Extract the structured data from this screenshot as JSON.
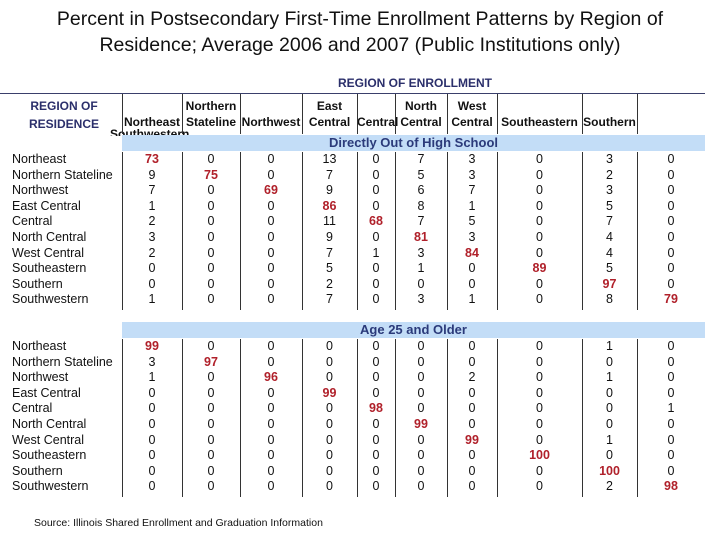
{
  "title_line1": "Percent in Postsecondary First-Time Enrollment Patterns by Region of",
  "title_line2": "Residence; Average 2006 and 2007 (Public Institutions only)",
  "enrollment_header": "REGION OF ENROLLMENT",
  "residence_header_line1": "REGION OF",
  "residence_header_line2": "RESIDENCE",
  "residence_overlap_text": "Southwestern",
  "columns": [
    {
      "line1": "",
      "line2": "Northeast"
    },
    {
      "line1": "Northern",
      "line2": "Stateline"
    },
    {
      "line1": "",
      "line2": "Northwest"
    },
    {
      "line1": "East",
      "line2": "Central"
    },
    {
      "line1": "",
      "line2": "Central"
    },
    {
      "line1": "North",
      "line2": "Central"
    },
    {
      "line1": "West",
      "line2": "Central"
    },
    {
      "line1": "",
      "line2": "Southeastern"
    },
    {
      "line1": "",
      "line2": "Southern"
    },
    {
      "line1": "",
      "line2": ""
    }
  ],
  "row_labels": [
    "Northeast",
    "Northern Stateline",
    "Northwest",
    "East Central",
    "Central",
    "North Central",
    "West Central",
    "Southeastern",
    "Southern",
    "Southwestern"
  ],
  "sections": [
    {
      "label": "Directly Out of High School",
      "rows": [
        [
          73,
          0,
          0,
          13,
          0,
          7,
          3,
          0,
          3,
          0
        ],
        [
          9,
          75,
          0,
          7,
          0,
          5,
          3,
          0,
          2,
          0
        ],
        [
          7,
          0,
          69,
          9,
          0,
          6,
          7,
          0,
          3,
          0
        ],
        [
          1,
          0,
          0,
          86,
          0,
          8,
          1,
          0,
          5,
          0
        ],
        [
          2,
          0,
          0,
          11,
          68,
          7,
          5,
          0,
          7,
          0
        ],
        [
          3,
          0,
          0,
          9,
          0,
          81,
          3,
          0,
          4,
          0
        ],
        [
          2,
          0,
          0,
          7,
          1,
          3,
          84,
          0,
          4,
          0
        ],
        [
          0,
          0,
          0,
          5,
          0,
          1,
          0,
          89,
          5,
          0
        ],
        [
          0,
          0,
          0,
          2,
          0,
          0,
          0,
          0,
          97,
          0
        ],
        [
          1,
          0,
          0,
          7,
          0,
          3,
          1,
          0,
          8,
          79
        ]
      ]
    },
    {
      "label": "Age 25 and Older",
      "rows": [
        [
          99,
          0,
          0,
          0,
          0,
          0,
          0,
          0,
          1,
          0
        ],
        [
          3,
          97,
          0,
          0,
          0,
          0,
          0,
          0,
          0,
          0
        ],
        [
          1,
          0,
          96,
          0,
          0,
          0,
          2,
          0,
          1,
          0
        ],
        [
          0,
          0,
          0,
          99,
          0,
          0,
          0,
          0,
          0,
          0
        ],
        [
          0,
          0,
          0,
          0,
          98,
          0,
          0,
          0,
          0,
          1
        ],
        [
          0,
          0,
          0,
          0,
          0,
          99,
          0,
          0,
          0,
          0
        ],
        [
          0,
          0,
          0,
          0,
          0,
          0,
          99,
          0,
          1,
          0
        ],
        [
          0,
          0,
          0,
          0,
          0,
          0,
          0,
          100,
          0,
          0
        ],
        [
          0,
          0,
          0,
          0,
          0,
          0,
          0,
          0,
          100,
          0
        ],
        [
          0,
          0,
          0,
          0,
          0,
          0,
          0,
          0,
          2,
          98
        ]
      ]
    }
  ],
  "colors": {
    "highlight": "#b0202a",
    "band": "#c3ddf7",
    "header_text": "#2b2f6b"
  },
  "source": "Source:  Illinois Shared Enrollment and Graduation Information"
}
